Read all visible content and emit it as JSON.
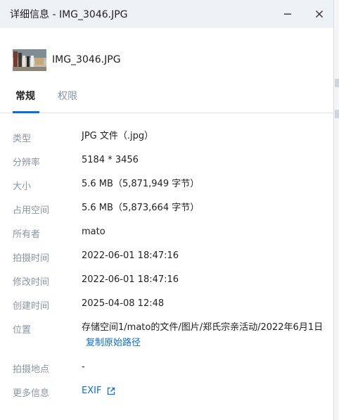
{
  "window": {
    "title": "详细信息 - IMG_3046.JPG"
  },
  "file": {
    "name": "IMG_3046.JPG"
  },
  "tabs": [
    {
      "label": "常规",
      "active": true
    },
    {
      "label": "权限",
      "active": false
    }
  ],
  "details": {
    "type": {
      "label": "类型",
      "value": "JPG 文件（.jpg）"
    },
    "resolution": {
      "label": "分辨率",
      "value": "5184 * 3456"
    },
    "size": {
      "label": "大小",
      "value": "5.6 MB（5,871,949 字节）"
    },
    "disk_usage": {
      "label": "占用空间",
      "value": "5.6 MB（5,873,664 字节）"
    },
    "owner": {
      "label": "所有者",
      "value": "mato"
    },
    "taken_time": {
      "label": "拍摄时间",
      "value": "2022-06-01 18:47:16"
    },
    "modified_time": {
      "label": "修改时间",
      "value": "2022-06-01 18:47:16"
    },
    "created_time": {
      "label": "创建时间",
      "value": "2025-04-08 12:48"
    },
    "location": {
      "label": "位置",
      "value": "存储空间1/mato的文件/图片/郑氏宗亲活动/2022年6月1日",
      "link": "复制原始路径"
    },
    "taken_place": {
      "label": "拍摄地点",
      "value": "-"
    },
    "more_info": {
      "label": "更多信息",
      "link": "EXIF"
    }
  },
  "colors": {
    "accent": "#0d6fd1",
    "label": "#8a96a3",
    "titlebar": "#eef1f5"
  },
  "icons": [
    "minimize-icon",
    "close-icon",
    "external-link-icon"
  ]
}
